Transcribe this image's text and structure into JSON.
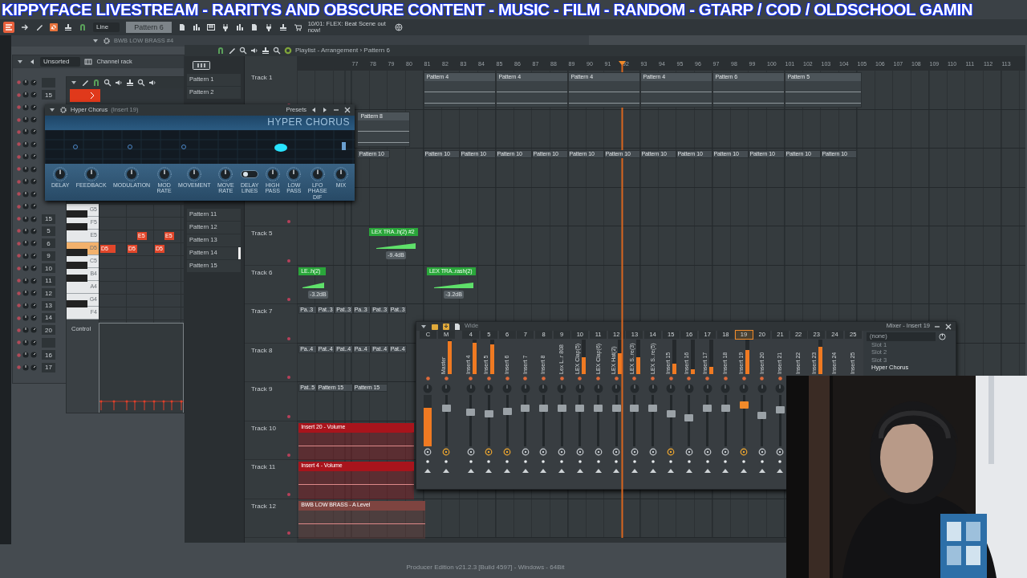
{
  "stream_banner": "KIPPYFACE LIVESTREAM  - RARITYS AND OBSCURE CONTENT - MUSIC - FILM - RANDOM - GTARP / COD / OLDSCHOOL GAMIN",
  "toolbar": {
    "snap": "Line",
    "pattern": "Pattern 6",
    "news": "10/01: FLEX: Beat Scene out now!"
  },
  "focused_plugin": "BWB LOW BRASS #4",
  "channel_rack": {
    "title": "Channel rack",
    "filter": "Unsorted",
    "rows": [
      {
        "kind": "blank"
      },
      {
        "kind": "channel",
        "number": "15"
      },
      {
        "kind": "covered"
      },
      {
        "kind": "covered"
      },
      {
        "kind": "covered"
      },
      {
        "kind": "covered"
      },
      {
        "kind": "covered"
      },
      {
        "kind": "covered"
      },
      {
        "kind": "covered"
      },
      {
        "kind": "covered"
      },
      {
        "kind": "covered"
      },
      {
        "kind": "channel",
        "number": "15"
      },
      {
        "kind": "channel",
        "number": "5"
      },
      {
        "kind": "channel",
        "number": "6"
      },
      {
        "kind": "channel",
        "number": "9"
      },
      {
        "kind": "channel",
        "number": "10"
      },
      {
        "kind": "channel",
        "number": "11"
      },
      {
        "kind": "channel",
        "number": "12"
      },
      {
        "kind": "channel",
        "number": "13"
      },
      {
        "kind": "channel",
        "number": "14"
      },
      {
        "kind": "channel",
        "number": "20"
      },
      {
        "kind": "blank"
      },
      {
        "kind": "channel",
        "number": "16"
      },
      {
        "kind": "channel",
        "number": "17"
      }
    ]
  },
  "piano_roll": {
    "keys": [
      {
        "label": "G5",
        "highlighted": false
      },
      {
        "label": "F5",
        "highlighted": false
      },
      {
        "label": "E5",
        "highlighted": false
      },
      {
        "label": "D5",
        "highlighted": true
      },
      {
        "label": "C5",
        "highlighted": false
      },
      {
        "label": "B4",
        "highlighted": false
      },
      {
        "label": "A4",
        "highlighted": false
      },
      {
        "label": "G4",
        "highlighted": false
      },
      {
        "label": "F4",
        "highlighted": false
      }
    ],
    "notes": [
      {
        "label": "E5"
      },
      {
        "label": "E5"
      },
      {
        "label": "D5"
      },
      {
        "label": "D5"
      },
      {
        "label": "D5"
      }
    ],
    "control": "Control"
  },
  "hyper_chorus": {
    "title": "Hyper Chorus",
    "subtitle": "(Insert 19)",
    "presets": "Presets",
    "logo": "HYPER CHORUS",
    "controls": [
      {
        "label": "DELAY",
        "kind": "knob"
      },
      {
        "label": "FEEDBACK",
        "kind": "knob"
      },
      {
        "label": "MODULATION",
        "kind": "knob"
      },
      {
        "label": "MOD RATE",
        "kind": "knob"
      },
      {
        "label": "MOVEMENT",
        "kind": "knob"
      },
      {
        "label": "MOVE RATE",
        "kind": "knob"
      },
      {
        "label": "DELAY LINES",
        "kind": "switch",
        "on": false
      },
      {
        "label": "HIGH PASS",
        "kind": "knob"
      },
      {
        "label": "LOW PASS",
        "kind": "knob"
      },
      {
        "label": "LFO PHASE DIF",
        "kind": "knob"
      },
      {
        "label": "MIX",
        "kind": "knob"
      }
    ]
  },
  "playlist": {
    "title": "Playlist - Arrangement › Pattern 6",
    "pattern_groups": [
      {
        "items": [
          {
            "label": "Pattern 1",
            "selected": false
          },
          {
            "label": "Pattern 2",
            "selected": false
          }
        ]
      },
      {
        "items": [
          {
            "label": "Pattern 11",
            "selected": false
          },
          {
            "label": "Pattern 12",
            "selected": false
          },
          {
            "label": "Pattern 13",
            "selected": false
          },
          {
            "label": "Pattern 14",
            "selected": true
          },
          {
            "label": "Pattern 15",
            "selected": false
          }
        ]
      }
    ],
    "ruler": [
      "77",
      "78",
      "79",
      "80",
      "81",
      "82",
      "83",
      "84",
      "85",
      "86",
      "87",
      "88",
      "89",
      "90",
      "91",
      "92",
      "93",
      "94",
      "95",
      "96",
      "97",
      "98",
      "99",
      "100",
      "101",
      "102",
      "103",
      "104",
      "105",
      "106",
      "107",
      "108",
      "109",
      "110",
      "111",
      "112",
      "113"
    ],
    "tracks": [
      {
        "name": "Track 1",
        "kind": "track",
        "clips": [
          {
            "kind": "notes",
            "label": "Pattern 4"
          },
          {
            "kind": "notes",
            "label": "Pattern 4"
          },
          {
            "kind": "notes",
            "label": "Pattern 4"
          },
          {
            "kind": "notes",
            "label": "Pattern 4"
          },
          {
            "kind": "notes",
            "label": "Pattern 6"
          },
          {
            "kind": "notes",
            "label": "Pattern 5"
          }
        ]
      },
      {
        "kind": "track",
        "clips": [
          {
            "kind": "notes",
            "label": "Pattern 8"
          }
        ]
      },
      {
        "kind": "track",
        "clips": [
          {
            "kind": "pattern",
            "label": "Pattern 10"
          },
          {
            "kind": "pattern",
            "label": "Pattern 10"
          },
          {
            "kind": "pattern",
            "label": "Pattern 10"
          },
          {
            "kind": "pattern",
            "label": "Pattern 10"
          },
          {
            "kind": "pattern",
            "label": "Pattern 10"
          },
          {
            "kind": "pattern",
            "label": "Pattern 10"
          },
          {
            "kind": "pattern",
            "label": "Pattern 10"
          },
          {
            "kind": "pattern",
            "label": "Pattern 10"
          },
          {
            "kind": "pattern",
            "label": "Pattern 10"
          },
          {
            "kind": "pattern",
            "label": "Pattern 10"
          },
          {
            "kind": "pattern",
            "label": "Pattern 10"
          },
          {
            "kind": "pattern",
            "label": "Pattern 10"
          },
          {
            "kind": "pattern",
            "label": "Pattern 10"
          }
        ]
      },
      {
        "kind": "track"
      },
      {
        "name": "Track 5",
        "kind": "track",
        "clips": [
          {
            "kind": "audio",
            "label": "LEX TRA..h(2) #2",
            "gain": "-9.4dB"
          }
        ]
      },
      {
        "name": "Track 6",
        "kind": "track",
        "clips": [
          {
            "kind": "audio",
            "label": "LE..h(2)",
            "gain": "-3.2dB"
          },
          {
            "kind": "audio",
            "label": "LEX TRA..rash(2)",
            "gain": "-3.2dB"
          }
        ]
      },
      {
        "name": "Track 7",
        "kind": "track",
        "clips": [
          {
            "kind": "pattern",
            "label": "Pa..3"
          },
          {
            "kind": "pattern",
            "label": "Pat..3"
          },
          {
            "kind": "pattern",
            "label": "Pat..3"
          },
          {
            "kind": "pattern",
            "label": "Pa..3"
          },
          {
            "kind": "pattern",
            "label": "Pat..3"
          },
          {
            "kind": "pattern",
            "label": "Pat..3"
          }
        ]
      },
      {
        "name": "Track 8",
        "kind": "track",
        "clips": [
          {
            "kind": "pattern",
            "label": "Pa..4"
          },
          {
            "kind": "pattern",
            "label": "Pat..4"
          },
          {
            "kind": "pattern",
            "label": "Pat..4"
          },
          {
            "kind": "pattern",
            "label": "Pa..4"
          },
          {
            "kind": "pattern",
            "label": "Pat..4"
          },
          {
            "kind": "pattern",
            "label": "Pat..4"
          }
        ]
      },
      {
        "name": "Track 9",
        "kind": "track",
        "clips": [
          {
            "kind": "pattern",
            "label": "Pat..5"
          },
          {
            "kind": "pattern",
            "label": "Pattern 15"
          },
          {
            "kind": "pattern",
            "label": "Pattern 15"
          }
        ]
      },
      {
        "name": "Track 10",
        "kind": "track",
        "clips": [
          {
            "kind": "automation",
            "label": "Insert 20 - Volume",
            "color": "#a8141c"
          }
        ]
      },
      {
        "name": "Track 11",
        "kind": "track",
        "clips": [
          {
            "kind": "automation",
            "label": "Insert 4 - Volume",
            "color": "#a8141c"
          }
        ]
      },
      {
        "name": "Track 12",
        "kind": "track",
        "clips": [
          {
            "kind": "automation",
            "label": "BWB LOW BRASS - A Level",
            "color": "#7e4440"
          }
        ]
      }
    ]
  },
  "mixer": {
    "title": "Mixer - Insert 19",
    "stereo": "Wide",
    "input": "(none)",
    "slots": [
      {
        "label": "Slot 1",
        "active": false
      },
      {
        "label": "Slot 2",
        "active": false
      },
      {
        "label": "Slot 3",
        "active": false
      },
      {
        "label": "Hyper Chorus",
        "active": true
      }
    ],
    "strips": [
      {
        "number": "C",
        "kind": "current",
        "selected": false,
        "linked": false,
        "meter": {
          "level": 0.75
        }
      },
      {
        "number": "M",
        "name": "Master",
        "kind": "master",
        "selected": false,
        "linked": true,
        "meter": {
          "level": 0.95
        },
        "fader": {
          "level": 0.78
        }
      },
      {
        "number": "4",
        "name": "Insert 4",
        "kind": "insert",
        "selected": false,
        "linked": false,
        "meter": {
          "level": 0.9
        },
        "fader": {
          "level": 0.7
        }
      },
      {
        "number": "5",
        "name": "Insert 5",
        "kind": "insert",
        "selected": false,
        "linked": true,
        "meter": {
          "level": 0.85
        },
        "fader": {
          "level": 0.65
        }
      },
      {
        "number": "6",
        "name": "Insert 6",
        "kind": "insert",
        "selected": false,
        "linked": true,
        "fader": {
          "level": 0.71
        }
      },
      {
        "number": "7",
        "name": "Insert 7",
        "kind": "insert",
        "selected": false,
        "linked": false,
        "fader": {
          "level": 0.78
        }
      },
      {
        "number": "8",
        "name": "Insert 8",
        "kind": "insert",
        "selected": false,
        "linked": false,
        "fader": {
          "level": 0.78
        }
      },
      {
        "number": "9",
        "name": "Lex L..r 808",
        "kind": "insert",
        "selected": false,
        "linked": false,
        "fader": {
          "level": 0.78
        }
      },
      {
        "number": "10",
        "name": "LEX Clap(5)",
        "kind": "insert",
        "selected": false,
        "linked": false,
        "meter": {
          "level": 0.5
        },
        "fader": {
          "level": 0.78
        }
      },
      {
        "number": "11",
        "name": "LEX Clap(6)",
        "kind": "insert",
        "selected": false,
        "linked": false,
        "fader": {
          "level": 0.78
        }
      },
      {
        "number": "12",
        "name": "LEX Hat(2)",
        "kind": "insert",
        "selected": false,
        "linked": false,
        "meter": {
          "level": 0.6
        },
        "fader": {
          "level": 0.78
        }
      },
      {
        "number": "13",
        "name": "LEX S..re(3)",
        "kind": "insert",
        "selected": false,
        "linked": false,
        "meter": {
          "level": 0.5
        },
        "fader": {
          "level": 0.78
        }
      },
      {
        "number": "14",
        "name": "LEX S..re(5)",
        "kind": "insert",
        "selected": false,
        "linked": false,
        "fader": {
          "level": 0.78
        }
      },
      {
        "number": "15",
        "name": "Insert 15",
        "kind": "insert",
        "selected": false,
        "linked": true,
        "meter": {
          "level": 0.3
        },
        "fader": {
          "level": 0.66
        }
      },
      {
        "number": "16",
        "name": "Insert 16",
        "kind": "insert",
        "selected": false,
        "linked": false,
        "meter": {
          "level": 0.15
        },
        "fader": {
          "level": 0.57
        }
      },
      {
        "number": "17",
        "name": "Insert 17",
        "kind": "insert",
        "selected": false,
        "linked": false,
        "meter": {
          "level": 0.2
        },
        "fader": {
          "level": 0.78
        }
      },
      {
        "number": "18",
        "name": "Insert 18",
        "kind": "insert",
        "selected": false,
        "linked": false,
        "fader": {
          "level": 0.78
        }
      },
      {
        "number": "19",
        "name": "Insert 19",
        "kind": "insert",
        "selected": true,
        "linked": true,
        "meter": {
          "level": 0.7
        },
        "fader": {
          "level": 0.86
        }
      },
      {
        "number": "20",
        "name": "Insert 20",
        "kind": "insert",
        "selected": false,
        "linked": false,
        "fader": {
          "level": 0.62
        }
      },
      {
        "number": "21",
        "name": "Insert 21",
        "kind": "insert",
        "selected": false,
        "linked": false,
        "fader": {
          "level": 0.74
        }
      },
      {
        "number": "22",
        "name": "Insert 22",
        "kind": "insert",
        "selected": false
      },
      {
        "number": "23",
        "name": "Insert 23",
        "kind": "insert",
        "selected": false,
        "meter": {
          "level": 0.8
        }
      },
      {
        "number": "24",
        "name": "Insert 24",
        "kind": "insert",
        "selected": false
      },
      {
        "number": "25",
        "name": "Insert 25",
        "kind": "insert",
        "selected": false
      }
    ]
  },
  "status": "Producer Edition v21.2.3 [Build 4597] - Windows - 64Bit"
}
